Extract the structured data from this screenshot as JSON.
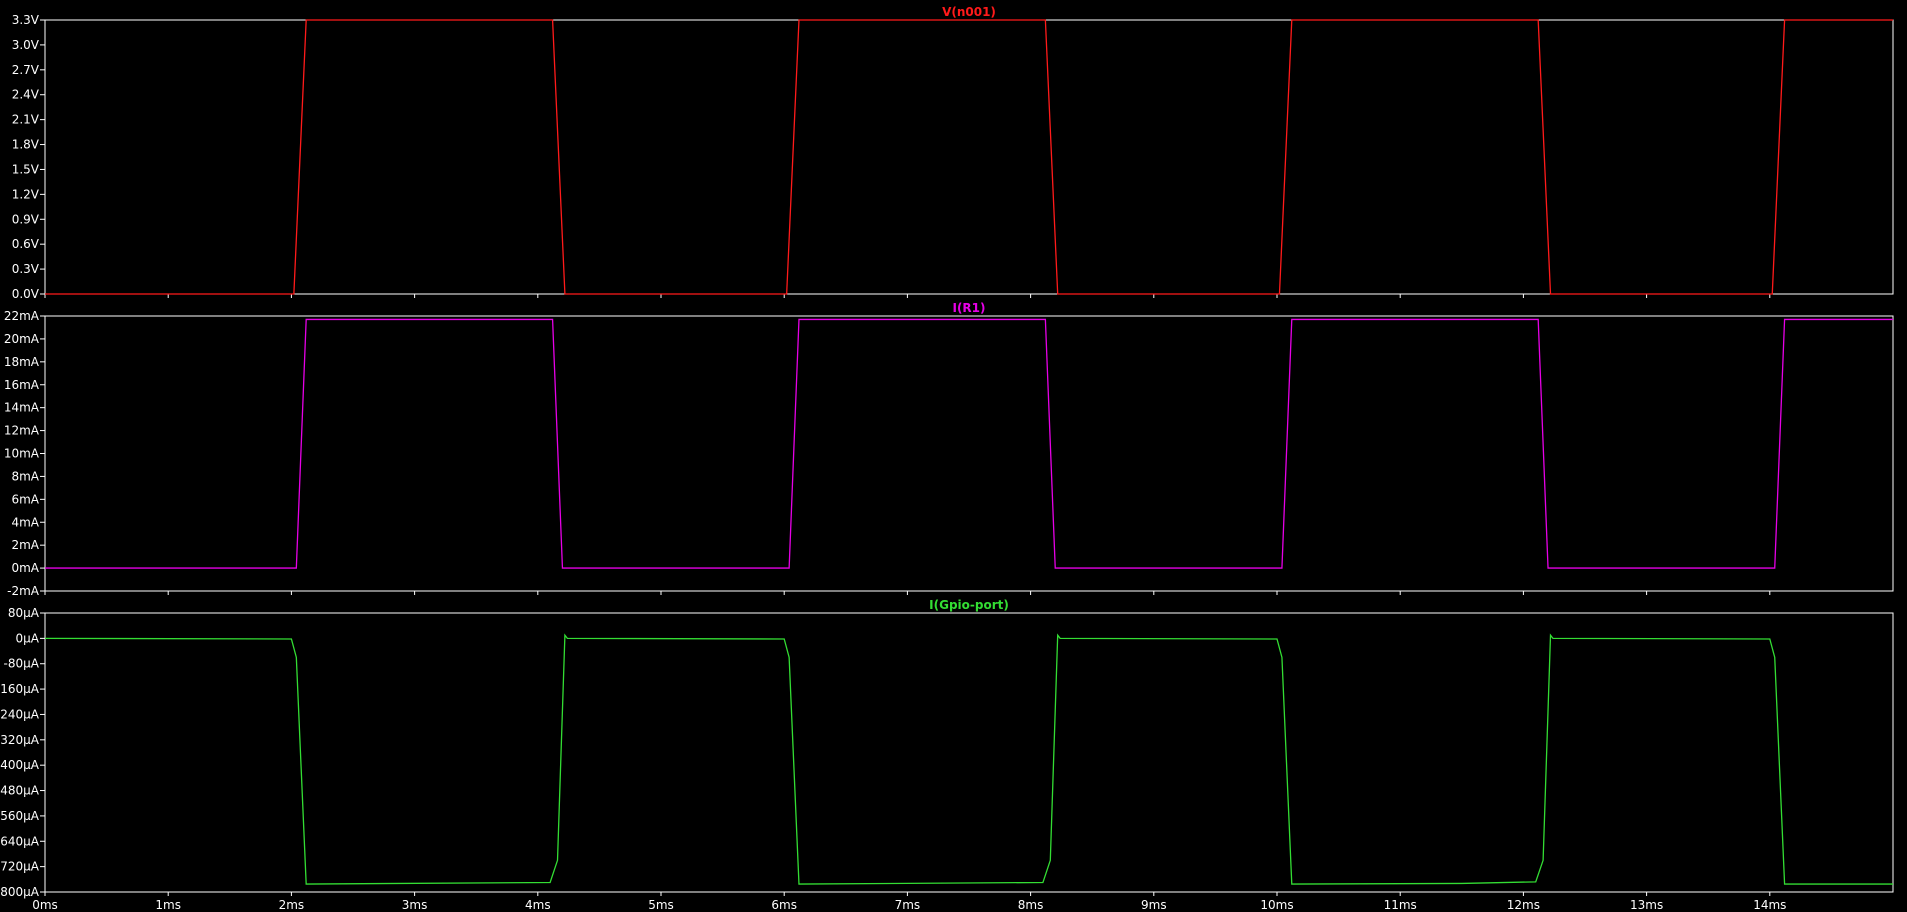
{
  "chart_data": [
    {
      "type": "line",
      "title": "V(n001)",
      "color": "#ff1a1a",
      "xlim": [
        0,
        15
      ],
      "ylim": [
        0,
        3.3
      ],
      "yticks": [
        "0.0V",
        "0.3V",
        "0.6V",
        "0.9V",
        "1.2V",
        "1.5V",
        "1.8V",
        "2.1V",
        "2.4V",
        "2.7V",
        "3.0V",
        "3.3V"
      ],
      "series": [
        {
          "x": [
            0,
            2.02,
            2.12,
            4.12,
            4.22,
            6.02,
            6.12,
            8.12,
            8.22,
            10.02,
            10.12,
            12.12,
            12.22,
            14.02,
            14.12,
            15
          ],
          "y": [
            0,
            0,
            3.3,
            3.3,
            0,
            0,
            3.3,
            3.3,
            0,
            0,
            3.3,
            3.3,
            0,
            0,
            3.3,
            3.3
          ]
        }
      ]
    },
    {
      "type": "line",
      "title": "I(R1)",
      "color": "#e600e6",
      "xlim": [
        0,
        15
      ],
      "ylim": [
        -2,
        22
      ],
      "yticks": [
        "-2mA",
        "0mA",
        "2mA",
        "4mA",
        "6mA",
        "8mA",
        "10mA",
        "12mA",
        "14mA",
        "16mA",
        "18mA",
        "20mA",
        "22mA"
      ],
      "series": [
        {
          "x": [
            0,
            2.04,
            2.12,
            4.12,
            4.2,
            6.04,
            6.12,
            8.12,
            8.2,
            10.04,
            10.12,
            12.12,
            12.2,
            14.04,
            14.12,
            15
          ],
          "y": [
            0,
            0,
            21.7,
            21.7,
            0,
            0,
            21.7,
            21.7,
            0,
            0,
            21.7,
            21.7,
            0,
            0,
            21.7,
            21.7
          ]
        }
      ]
    },
    {
      "type": "line",
      "title": "I(Gpio-port)",
      "color": "#33dd33",
      "xlim": [
        0,
        15
      ],
      "ylim": [
        -800,
        80
      ],
      "yticks": [
        "-800µA",
        "-720µA",
        "-640µA",
        "-560µA",
        "-480µA",
        "-400µA",
        "-320µA",
        "-240µA",
        "-160µA",
        "-80µA",
        "0µA",
        "80µA"
      ],
      "series": [
        {
          "x": [
            0,
            2.0,
            2.04,
            2.12,
            4.1,
            4.16,
            4.22,
            4.24,
            6.0,
            6.04,
            6.12,
            8.1,
            8.16,
            8.22,
            8.24,
            10.0,
            10.04,
            10.12,
            11.5,
            12.1,
            12.16,
            12.22,
            12.24,
            14.0,
            14.04,
            14.12,
            15
          ],
          "y": [
            0,
            -2,
            -60,
            -775,
            -770,
            -700,
            10,
            0,
            -2,
            -60,
            -775,
            -770,
            -700,
            10,
            0,
            -2,
            -60,
            -775,
            -773,
            -768,
            -700,
            10,
            0,
            -2,
            -60,
            -775,
            -775
          ]
        }
      ]
    }
  ],
  "x_axis": {
    "ticks": [
      "0ms",
      "1ms",
      "2ms",
      "3ms",
      "4ms",
      "5ms",
      "6ms",
      "7ms",
      "8ms",
      "9ms",
      "10ms",
      "11ms",
      "12ms",
      "13ms",
      "14ms"
    ]
  }
}
